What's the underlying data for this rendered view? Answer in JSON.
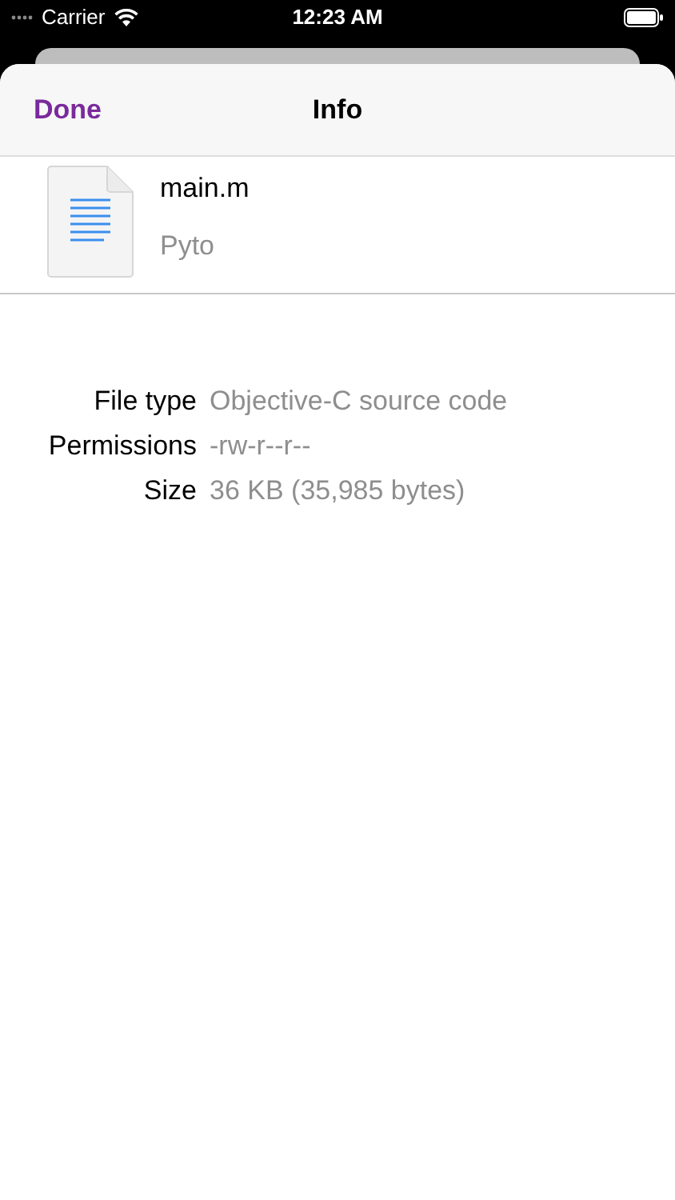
{
  "status_bar": {
    "carrier": "Carrier",
    "time": "12:23 AM"
  },
  "nav_bar": {
    "done": "Done",
    "title": "Info"
  },
  "file": {
    "name": "main.m",
    "location": "Pyto"
  },
  "properties": [
    {
      "label": "File type",
      "value": "Objective-C source code"
    },
    {
      "label": "Permissions",
      "value": "-rw-r--r--"
    },
    {
      "label": "Size",
      "value": "36 KB (35,985 bytes)"
    }
  ]
}
